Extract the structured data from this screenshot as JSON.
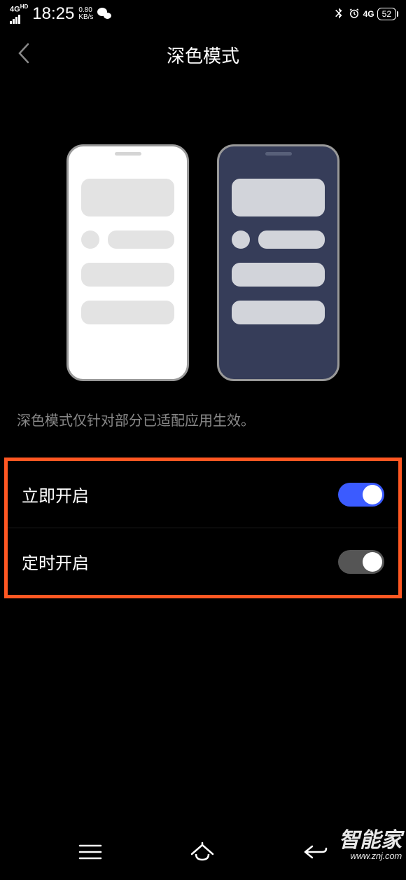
{
  "status": {
    "network_label": "4G",
    "network_sub": "HD",
    "time": "18:25",
    "speed_value": "0.80",
    "speed_unit": "KB/s",
    "cellular_indicator": "4G",
    "battery_percent": "52"
  },
  "header": {
    "title": "深色模式"
  },
  "description": "深色模式仅针对部分已适配应用生效。",
  "settings": {
    "enable_now": {
      "label": "立即开启",
      "on": true
    },
    "scheduled": {
      "label": "定时开启",
      "on": false
    }
  },
  "watermark": {
    "text": "智能家",
    "url": "www.znj.com"
  }
}
